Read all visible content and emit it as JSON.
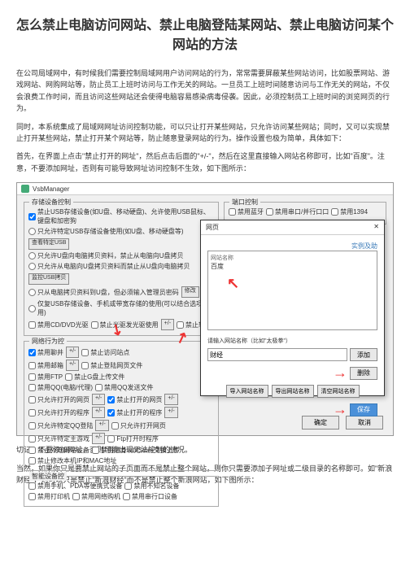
{
  "title": "怎么禁止电脑访问网站、禁止电脑登陆某网站、禁止电脑访问某个网站的方法",
  "para1": "在公司局域网中，有时候我们需要控制局域网用户访问网站的行为，常常需要屏蔽某些网站访问，比如股票网站、游戏网站、网购网站等，防止员工上班时访问与工作无关的网站。一旦员工上班时间随意访问与工作无关的网站，不仅会浪费工作时间，而且访问这些网站还会使得电脑容易感染病毒侵袭。因此，必须控制员工上班时间的浏览网页的行为。",
  "para2": "同时，本系统集成了局域网网址访问控制功能，可以只让打开某些网站，只允许访问某些网站；同时，又可以实现禁止打开某些网站，禁止打开某个网站等，防止随意登录网站的行为。操作设置也极为简单，具体如下：",
  "para3": "首先，在界面上点击\"禁止打开的网址\"，然后点击后面的\"+/-\"，然后在这里直接输入网站名称即可，比如\"百度\"。注意，不要添加网址，否则有可能导致网址访问控制不生效，如下图所示：",
  "para4": "切记，不要添加网址，否则可能出现无法控制的情况。",
  "para5": "当然，如果你只是要禁止网站的子页面而不是禁止整个网站，则你只需要添加子网址或二级目录的名称即可。如\"新浪财经\"，则可以只是禁止\"新浪财经\"而不是禁止整个新浪网站，如下图所示：",
  "app": {
    "title": "VsbManager",
    "groups": {
      "storage": "存储设备控制",
      "port": "端口控制"
    },
    "storage_main": "禁止USB存储设备(如U盘、移动硬盘)、允许使用USB鼠标、键盘和加密狗",
    "storage_opts": {
      "r1a": "只允许特定USB存储设备使用(如U盘、移动硬盘等)",
      "r1b": "查看特定USB",
      "r2": "只允许U盘向电脑拷贝资料，禁止从电脑向U盘拷贝",
      "r3a": "只允许从电脑向U盘拷贝资料而禁止从U盘向电脑拷贝",
      "r3b": "监控USB拷贝",
      "r4a": "只从电脑拷贝资料到U盘，但必须输入管理员密码",
      "r4b": "修改",
      "r5": "仅复USB存储设备、手机或带宽存储的使用(可以结合选项使用)",
      "c1": "禁用CD/DVD光驱",
      "c2": "禁止光驱发光驱使用",
      "c3": "禁止软",
      "net_group": "网络行为控",
      "n1": "禁用聊井",
      "n2": "禁止访问站点",
      "n3": "禁用邮箱",
      "n4": "禁止登陆网页文件",
      "n5": "禁用FTP",
      "n6": "禁止G盘上传文件",
      "n7": "禁用QQ(电脑/代理)",
      "n8": "禁用QQ发送文件",
      "n9": "只允许打开的网页",
      "n10": "禁止打开的网页",
      "n11": "只允许打开的程序",
      "n12": "禁止打开的程序",
      "n13": "只允许特定QQ登陆",
      "n14": "只允许打开网页",
      "n15": "只允许特定主游戏",
      "n16": "Ftp打开时程序",
      "n17": "禁止外连网站设备",
      "n18": "禁用随身wifi/Store交换上传",
      "n19": "禁止修改本机IP和MAC地址",
      "dev_group": "智能设备控",
      "d1": "禁用手机、PDA等便携式设备",
      "d2": "禁用不知名设备",
      "d3": "禁用打印机",
      "d4": "禁用网络购机",
      "d5": "禁用串行口设备"
    },
    "port_opts": {
      "p1": "禁用蓝牙",
      "p2": "禁用串口/并行口口",
      "p3": "禁用1394"
    },
    "btns": {
      "ok": "确定",
      "cancel": "取消"
    }
  },
  "dialog": {
    "title": "网页",
    "help": "实例及助",
    "list_header": "网站名称",
    "list_item": "百度",
    "input_label": "请输入网站名称（比如\"太极拳\"）",
    "input_value": "财经",
    "add": "添加",
    "del": "删除",
    "import": "导入网站名称",
    "export": "导出网站名称",
    "clear": "清空网站名称",
    "save": "保存"
  }
}
